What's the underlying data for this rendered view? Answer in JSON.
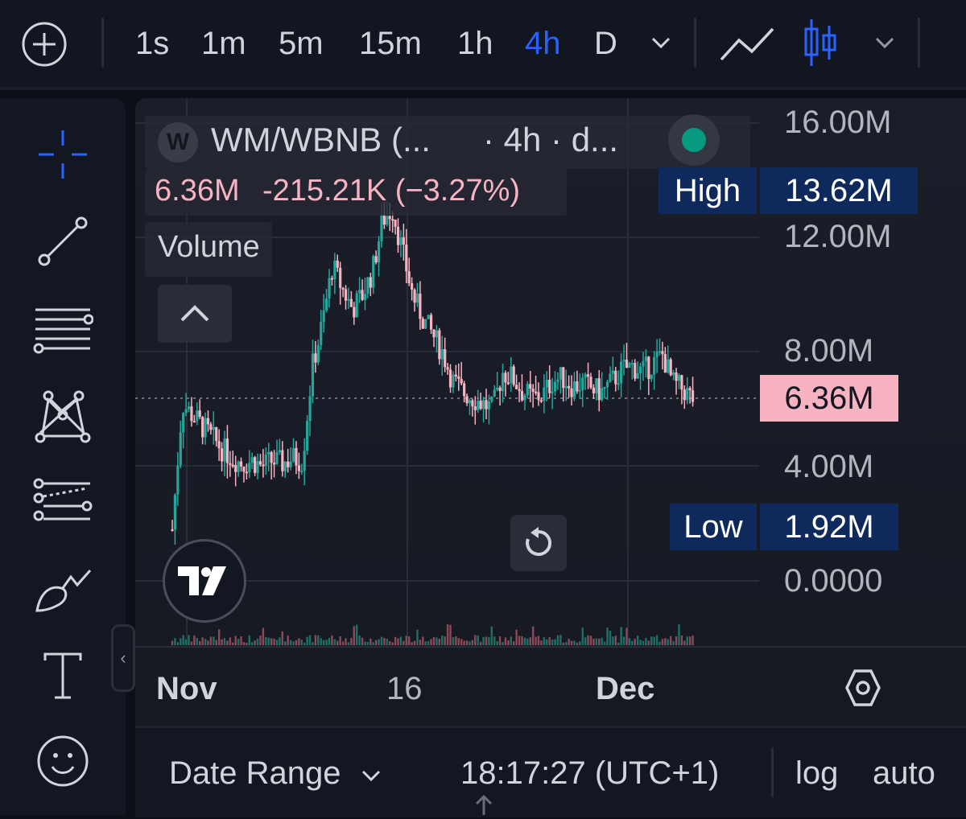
{
  "toolbar": {
    "timeframes": [
      "1s",
      "1m",
      "5m",
      "15m",
      "1h",
      "4h",
      "D"
    ],
    "active_timeframe": "4h"
  },
  "legend": {
    "symbol_initial": "W",
    "symbol": "WM/WBNB (...",
    "interval_info": "· 4h · d...",
    "last_price": "6.36M",
    "change": "-215.21K (−3.27%)",
    "volume_label": "Volume"
  },
  "price_axis": {
    "ticks": [
      "16.00M",
      "12.00M",
      "8.00M",
      "4.00M",
      "0.0000"
    ],
    "high_label": "High",
    "high_value": "13.62M",
    "low_label": "Low",
    "low_value": "1.92M",
    "current_value": "6.36M"
  },
  "time_axis": {
    "labels": [
      "Nov",
      "16",
      "Dec"
    ]
  },
  "bottom_bar": {
    "date_range": "Date Range",
    "clock": "18:17:27 (UTC+1)",
    "log": "log",
    "auto": "auto"
  },
  "colors": {
    "up": "#26a69a",
    "down": "#f7b3c2",
    "accent": "#2962ff",
    "tag_bg": "#0e2a5c"
  },
  "chart_data": {
    "type": "candlestick",
    "ylim": [
      0,
      16000000
    ],
    "high": 13620000,
    "low": 1920000,
    "last": 6360000,
    "approx_close_series_M": [
      1.8,
      6.2,
      5.8,
      5.4,
      5.0,
      4.6,
      4.3,
      4.1,
      4.2,
      4.0,
      4.2,
      4.1,
      4.3,
      4.2,
      7.5,
      9.0,
      11.0,
      10.2,
      9.5,
      10.0,
      10.8,
      12.6,
      13.0,
      11.5,
      10.0,
      9.2,
      8.6,
      8.0,
      7.0,
      6.6,
      6.4,
      6.2,
      6.0,
      7.3,
      7.1,
      6.6,
      6.4,
      6.5,
      7.0,
      7.1,
      6.8,
      6.9,
      6.7,
      6.6,
      7.0,
      7.4,
      7.5,
      7.3,
      7.6,
      7.9,
      6.9,
      6.7,
      6.36
    ]
  }
}
